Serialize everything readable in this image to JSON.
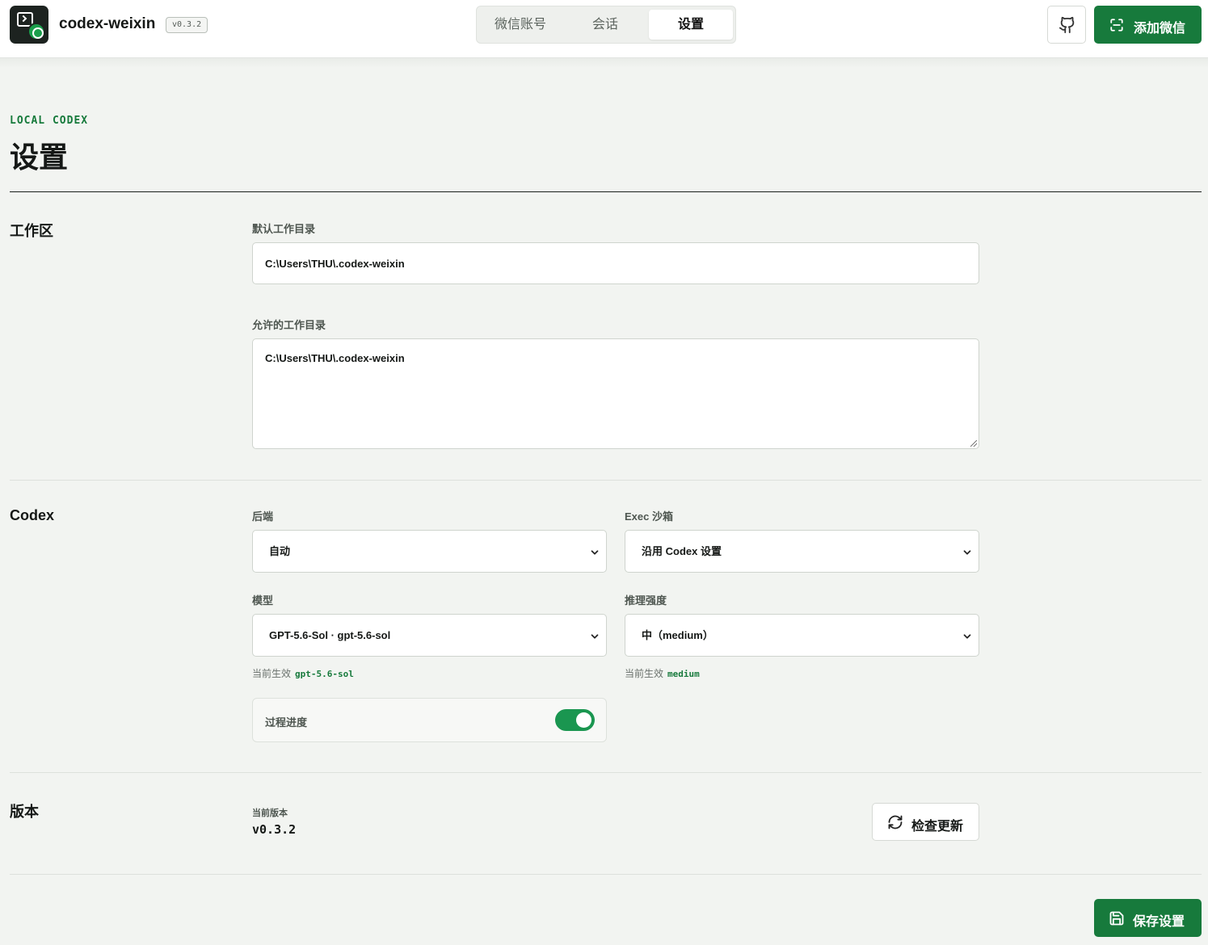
{
  "header": {
    "app_name": "codex-weixin",
    "version_badge": "v0.3.2",
    "tabs": [
      {
        "label": "微信账号",
        "active": false
      },
      {
        "label": "会话",
        "active": false
      },
      {
        "label": "设置",
        "active": true
      }
    ],
    "github_icon": "github-icon",
    "add_button_label": "添加微信",
    "add_button_icon": "scan-icon"
  },
  "page": {
    "eyebrow": "LOCAL CODEX",
    "title": "设置"
  },
  "workspace": {
    "section_title": "工作区",
    "default_dir_label": "默认工作目录",
    "default_dir_value": "C:\\Users\\THU\\.codex-weixin",
    "allowed_dirs_label": "允许的工作目录",
    "allowed_dirs_value": "C:\\Users\\THU\\.codex-weixin"
  },
  "codex": {
    "section_title": "Codex",
    "backend_label": "后端",
    "backend_value": "自动",
    "sandbox_label": "Exec 沙箱",
    "sandbox_value": "沿用 Codex 设置",
    "model_label": "模型",
    "model_value": "GPT-5.6-Sol · gpt-5.6-sol",
    "model_hint_prefix": "当前生效",
    "model_hint_code": "gpt-5.6-sol",
    "effort_label": "推理强度",
    "effort_value": "中（medium）",
    "effort_hint_prefix": "当前生效",
    "effort_hint_code": "medium",
    "progress_label": "过程进度",
    "progress_enabled": true
  },
  "version": {
    "section_title": "版本",
    "current_label": "当前版本",
    "current_value": "v0.3.2",
    "check_button_label": "检查更新",
    "check_button_icon": "refresh-icon"
  },
  "footer": {
    "save_button_label": "保存设置",
    "save_button_icon": "save-icon"
  },
  "colors": {
    "accent": "#177a3c",
    "background": "#f2f4f1",
    "toggle_on": "#1a9650"
  }
}
